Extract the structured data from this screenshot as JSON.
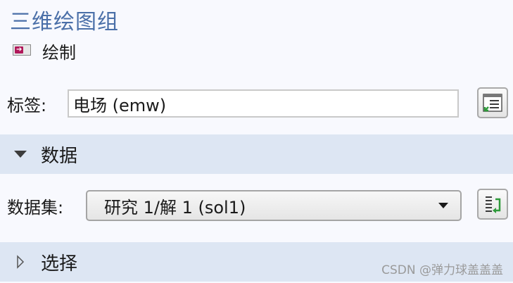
{
  "panel": {
    "title": "三维绘图组"
  },
  "plot_action": {
    "label": "绘制",
    "icon": "plot-icon"
  },
  "label_field": {
    "label": "标签:",
    "value": "电场 (emw)"
  },
  "data_section": {
    "label": "数据",
    "expanded": true
  },
  "dataset": {
    "label": "数据集:",
    "selected": "研究 1/解 1 (sol1)"
  },
  "selection_section": {
    "label": "选择",
    "expanded": false
  },
  "watermark": "CSDN @弹力球盖盖盖"
}
